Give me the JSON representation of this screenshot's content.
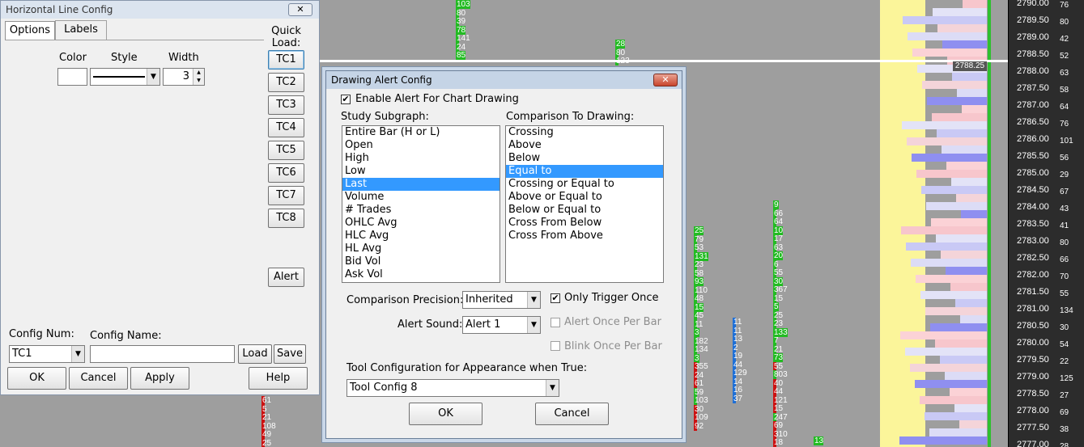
{
  "chart": {
    "price_labels": [
      "2790.00",
      "2789.50",
      "2789.00",
      "2788.50",
      "2788.00",
      "2787.50",
      "2787.00",
      "2786.50",
      "2786.00",
      "2785.50",
      "2785.00",
      "2784.50",
      "2784.00",
      "2783.50",
      "2783.00",
      "2782.50",
      "2782.00",
      "2781.50",
      "2781.00",
      "2780.50",
      "2780.00",
      "2779.50",
      "2779.00",
      "2778.50",
      "2778.00",
      "2777.50",
      "2777.00"
    ],
    "edge_numbers": [
      "76",
      "80",
      "42",
      "52",
      "63",
      "58",
      "64",
      "76",
      "101",
      "56",
      "29",
      "67",
      "43",
      "41",
      "80",
      "66",
      "70",
      "55",
      "134",
      "30",
      "54",
      "22",
      "125",
      "27",
      "69",
      "38",
      "28"
    ],
    "current_price": "2788.25",
    "cells": [
      {
        "t": "103",
        "c": "#22bb22"
      },
      {
        "t": "80",
        "c": "#22bb22"
      },
      {
        "t": "39",
        "c": "#22bb22"
      },
      {
        "t": "78",
        "c": "#22bb22"
      },
      {
        "t": "141",
        "c": "#22bb22"
      },
      {
        "t": "24",
        "c": "#22bb22"
      },
      {
        "t": "85",
        "c": "#22bb22"
      },
      {
        "t": "28",
        "c": "#22bb22"
      },
      {
        "t": "80",
        "c": "#22bb22"
      },
      {
        "t": "123",
        "c": "#22bb22"
      },
      {
        "t": "25",
        "c": "#22bb22"
      },
      {
        "t": "79",
        "c": "#22bb22"
      },
      {
        "t": "53",
        "c": "#22bb22"
      },
      {
        "t": "131",
        "c": "#22bb22"
      },
      {
        "t": "23",
        "c": "#22bb22"
      },
      {
        "t": "58",
        "c": "#22bb22"
      },
      {
        "t": "93",
        "c": "#22bb22"
      },
      {
        "t": "110",
        "c": "#22bb22"
      },
      {
        "t": "48",
        "c": "#22bb22"
      },
      {
        "t": "15",
        "c": "#22bb22"
      },
      {
        "t": "45",
        "c": "#22bb22"
      },
      {
        "t": "11",
        "c": "#22bb22"
      },
      {
        "t": "3",
        "c": "#22bb22"
      },
      {
        "t": "182",
        "c": "#22bb22"
      },
      {
        "t": "134",
        "c": "#22bb22"
      },
      {
        "t": "3",
        "c": "#22bb22"
      },
      {
        "t": "355",
        "c": "#cc1111"
      },
      {
        "t": "24",
        "c": "#cc1111"
      },
      {
        "t": "61",
        "c": "#cc1111"
      },
      {
        "t": "59",
        "c": "#22bb22"
      },
      {
        "t": "103",
        "c": "#22bb22"
      },
      {
        "t": "30",
        "c": "#cc1111"
      },
      {
        "t": "109",
        "c": "#cc1111"
      },
      {
        "t": "92",
        "c": "#cc1111"
      },
      {
        "t": "11",
        "c": "#1e6fd6"
      },
      {
        "t": "11",
        "c": "#1e6fd6"
      },
      {
        "t": "13",
        "c": "#1e6fd6"
      },
      {
        "t": "2",
        "c": "#1e6fd6"
      },
      {
        "t": "19",
        "c": "#1e6fd6"
      },
      {
        "t": "44",
        "c": "#1e6fd6"
      },
      {
        "t": "129",
        "c": "#1e6fd6"
      },
      {
        "t": "14",
        "c": "#1e6fd6"
      },
      {
        "t": "16",
        "c": "#1e6fd6"
      },
      {
        "t": "37",
        "c": "#1e6fd6"
      },
      {
        "t": "9",
        "c": "#22bb22"
      },
      {
        "t": "66",
        "c": "#22bb22"
      },
      {
        "t": "64",
        "c": "#22bb22"
      },
      {
        "t": "10",
        "c": "#22bb22"
      },
      {
        "t": "17",
        "c": "#22bb22"
      },
      {
        "t": "63",
        "c": "#22bb22"
      },
      {
        "t": "20",
        "c": "#22bb22"
      },
      {
        "t": "6",
        "c": "#22bb22"
      },
      {
        "t": "55",
        "c": "#22bb22"
      },
      {
        "t": "30",
        "c": "#22bb22"
      },
      {
        "t": "367",
        "c": "#22bb22"
      },
      {
        "t": "15",
        "c": "#22bb22"
      },
      {
        "t": "5",
        "c": "#22bb22"
      },
      {
        "t": "25",
        "c": "#22bb22"
      },
      {
        "t": "23",
        "c": "#22bb22"
      },
      {
        "t": "133",
        "c": "#22bb22"
      },
      {
        "t": "7",
        "c": "#22bb22"
      },
      {
        "t": "21",
        "c": "#22bb22"
      },
      {
        "t": "73",
        "c": "#22bb22"
      },
      {
        "t": "55",
        "c": "#cc1111"
      },
      {
        "t": "803",
        "c": "#22bb22"
      },
      {
        "t": "40",
        "c": "#cc1111"
      },
      {
        "t": "44",
        "c": "#cc1111"
      },
      {
        "t": "121",
        "c": "#cc1111"
      },
      {
        "t": "15",
        "c": "#cc1111"
      },
      {
        "t": "247",
        "c": "#22bb22"
      },
      {
        "t": "69",
        "c": "#cc1111"
      },
      {
        "t": "310",
        "c": "#cc1111"
      },
      {
        "t": "18",
        "c": "#cc1111"
      },
      {
        "t": "61",
        "c": "#cc1111"
      },
      {
        "t": "5",
        "c": "#cc1111"
      },
      {
        "t": "21",
        "c": "#cc1111"
      },
      {
        "t": "108",
        "c": "#cc1111"
      },
      {
        "t": "49",
        "c": "#cc1111"
      },
      {
        "t": "25",
        "c": "#cc1111"
      },
      {
        "t": "13",
        "c": "#22bb22"
      }
    ]
  },
  "hline_dialog": {
    "title": "Horizontal Line Config",
    "close": "✕",
    "tabs": [
      "Options",
      "Labels"
    ],
    "quick_load": "Quick Load:",
    "color_label": "Color",
    "style_label": "Style",
    "width_label": "Width",
    "width_value": "3",
    "tc_buttons": [
      "TC1",
      "TC2",
      "TC3",
      "TC4",
      "TC5",
      "TC6",
      "TC7",
      "TC8"
    ],
    "alert_button": "Alert",
    "config_num_label": "Config Num:",
    "config_num_value": "TC1",
    "config_name_label": "Config Name:",
    "config_name_value": "",
    "load": "Load",
    "save": "Save",
    "ok": "OK",
    "cancel": "Cancel",
    "apply": "Apply",
    "help": "Help"
  },
  "alert_dialog": {
    "title": "Drawing Alert Config",
    "close": "✕",
    "enable_label": "Enable Alert For Chart Drawing",
    "enable_checked": "✔",
    "study_label": "Study Subgraph:",
    "study_items": [
      "Entire Bar (H or L)",
      "Open",
      "High",
      "Low",
      "Last",
      "Volume",
      "# Trades",
      "OHLC Avg",
      "HLC Avg",
      "HL Avg",
      "Bid Vol",
      "Ask Vol"
    ],
    "study_selected": "Last",
    "comparison_label": "Comparison To Drawing:",
    "comparison_items": [
      "Crossing",
      "Above",
      "Below",
      "Equal to",
      "Crossing or Equal to",
      "Above or Equal to",
      "Below or Equal to",
      "Cross From Below",
      "Cross From Above"
    ],
    "comparison_selected": "Equal to",
    "precision_label": "Comparison Precision:",
    "precision_value": "Inherited",
    "sound_label": "Alert Sound:",
    "sound_value": "Alert 1",
    "only_once_label": "Only Trigger Once",
    "only_once_checked": "✔",
    "once_per_bar_label": "Alert Once Per Bar",
    "blink_label": "Blink Once Per Bar",
    "tool_config_label": "Tool Configuration for Appearance when True:",
    "tool_config_value": "Tool Config 8",
    "ok": "OK",
    "cancel": "Cancel"
  }
}
